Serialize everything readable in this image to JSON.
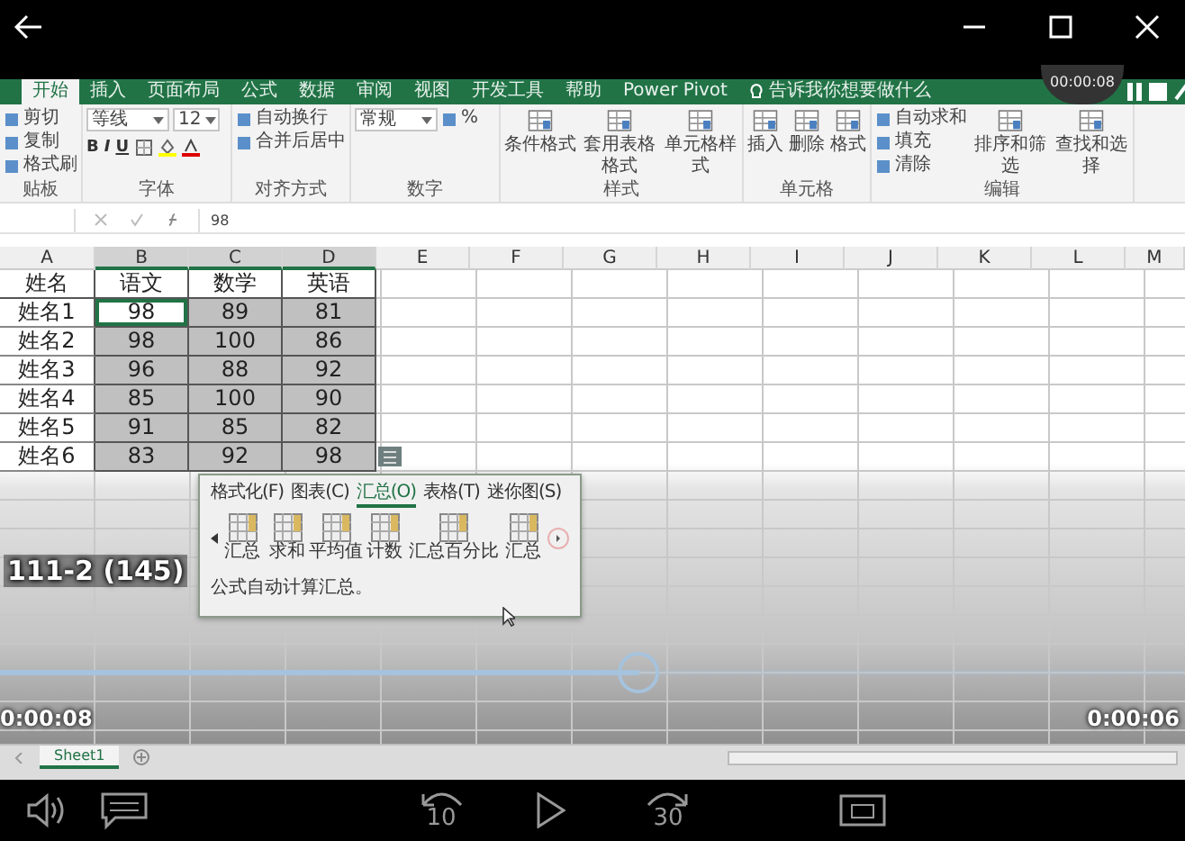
{
  "ribbon": {
    "tabs": [
      {
        "label": "开始",
        "selected": true
      },
      {
        "label": "插入",
        "selected": false
      },
      {
        "label": "页面布局",
        "selected": false
      },
      {
        "label": "公式",
        "selected": false
      },
      {
        "label": "数据",
        "selected": false
      },
      {
        "label": "审阅",
        "selected": false
      },
      {
        "label": "视图",
        "selected": false
      },
      {
        "label": "开发工具",
        "selected": false
      },
      {
        "label": "帮助",
        "selected": false
      },
      {
        "label": "Power Pivot",
        "selected": false
      }
    ],
    "tell_me": "告诉我你想要做什么",
    "groups": [
      {
        "label": "贴板",
        "items": [
          {
            "kind": "small",
            "label": "剪切"
          },
          {
            "kind": "small",
            "label": "复制"
          },
          {
            "kind": "small",
            "label": "格式刷"
          }
        ]
      },
      {
        "label": "字体",
        "items": [
          {
            "kind": "field",
            "value": "等线"
          },
          {
            "kind": "size",
            "value": "12"
          },
          {
            "kind": "letters",
            "letters": [
              "B",
              "I",
              "U"
            ]
          }
        ]
      },
      {
        "label": "对齐方式",
        "items": [
          {
            "kind": "small",
            "label": "自动换行"
          },
          {
            "kind": "small",
            "label": "合并后居中"
          }
        ]
      },
      {
        "label": "数字",
        "items": [
          {
            "kind": "field",
            "value": "常规"
          },
          {
            "kind": "small",
            "label": "%"
          }
        ]
      },
      {
        "label": "样式",
        "items": [
          {
            "kind": "large",
            "label": "条件格式"
          },
          {
            "kind": "large",
            "label": "套用表格格式"
          },
          {
            "kind": "large",
            "label": "单元格样式"
          }
        ]
      },
      {
        "label": "单元格",
        "items": [
          {
            "kind": "large",
            "label": "插入"
          },
          {
            "kind": "large",
            "label": "删除"
          },
          {
            "kind": "large",
            "label": "格式"
          }
        ]
      },
      {
        "label": "编辑",
        "items": [
          {
            "kind": "small",
            "label": "自动求和"
          },
          {
            "kind": "small",
            "label": "填充"
          },
          {
            "kind": "small",
            "label": "清除"
          },
          {
            "kind": "large",
            "label": "排序和筛选"
          },
          {
            "kind": "large",
            "label": "查找和选择"
          }
        ]
      }
    ]
  },
  "formula_bar": {
    "value": "98"
  },
  "sheet": {
    "columns": [
      {
        "label": "A",
        "selected": false
      },
      {
        "label": "B",
        "selected": true
      },
      {
        "label": "C",
        "selected": true
      },
      {
        "label": "D",
        "selected": true
      },
      {
        "label": "E",
        "selected": false
      },
      {
        "label": "F",
        "selected": false
      },
      {
        "label": "G",
        "selected": false
      },
      {
        "label": "H",
        "selected": false
      },
      {
        "label": "I",
        "selected": false
      },
      {
        "label": "J",
        "selected": false
      },
      {
        "label": "K",
        "selected": false
      },
      {
        "label": "L",
        "selected": false
      },
      {
        "label": "M",
        "selected": false
      }
    ],
    "rows": [
      {
        "kind": "header",
        "cells": [
          {
            "value": "姓名",
            "active": false
          },
          {
            "value": "语文",
            "active": false
          },
          {
            "value": "数学",
            "active": false
          },
          {
            "value": "英语",
            "active": false
          }
        ]
      },
      {
        "kind": "data",
        "cells": [
          {
            "value": "姓名1",
            "active": false
          },
          {
            "value": "98",
            "active": true
          },
          {
            "value": "89",
            "active": false
          },
          {
            "value": "81",
            "active": false
          }
        ]
      },
      {
        "kind": "data",
        "cells": [
          {
            "value": "姓名2",
            "active": false
          },
          {
            "value": "98",
            "active": false
          },
          {
            "value": "100",
            "active": false
          },
          {
            "value": "86",
            "active": false
          }
        ]
      },
      {
        "kind": "data",
        "cells": [
          {
            "value": "姓名3",
            "active": false
          },
          {
            "value": "96",
            "active": false
          },
          {
            "value": "88",
            "active": false
          },
          {
            "value": "92",
            "active": false
          }
        ]
      },
      {
        "kind": "data",
        "cells": [
          {
            "value": "姓名4",
            "active": false
          },
          {
            "value": "85",
            "active": false
          },
          {
            "value": "100",
            "active": false
          },
          {
            "value": "90",
            "active": false
          }
        ]
      },
      {
        "kind": "data",
        "cells": [
          {
            "value": "姓名5",
            "active": false
          },
          {
            "value": "91",
            "active": false
          },
          {
            "value": "85",
            "active": false
          },
          {
            "value": "82",
            "active": false
          }
        ]
      },
      {
        "kind": "data",
        "cells": [
          {
            "value": "姓名6",
            "active": false
          },
          {
            "value": "83",
            "active": false
          },
          {
            "value": "92",
            "active": false
          },
          {
            "value": "98",
            "active": false
          }
        ]
      }
    ],
    "sheet_tabs": [
      {
        "label": "Sheet1",
        "selected": true
      }
    ]
  },
  "quick_analysis": {
    "tabs": [
      {
        "label": "格式化(F)",
        "selected": false
      },
      {
        "label": "图表(C)",
        "selected": false
      },
      {
        "label": "汇总(O)",
        "selected": true
      },
      {
        "label": "表格(T)",
        "selected": false
      },
      {
        "label": "迷你图(S)",
        "selected": false
      }
    ],
    "items": [
      "汇总",
      "求和",
      "平均值",
      "计数",
      "汇总百分比",
      "汇总"
    ],
    "description": "公式自动计算汇总。"
  },
  "player": {
    "badge_time": "00:00:08",
    "overlay_text": "111-2 (145)",
    "elapsed": "0:00:08",
    "remaining": "0:00:06",
    "seek": {
      "level": 0.54
    },
    "skip_back": "10",
    "skip_forward": "30"
  }
}
